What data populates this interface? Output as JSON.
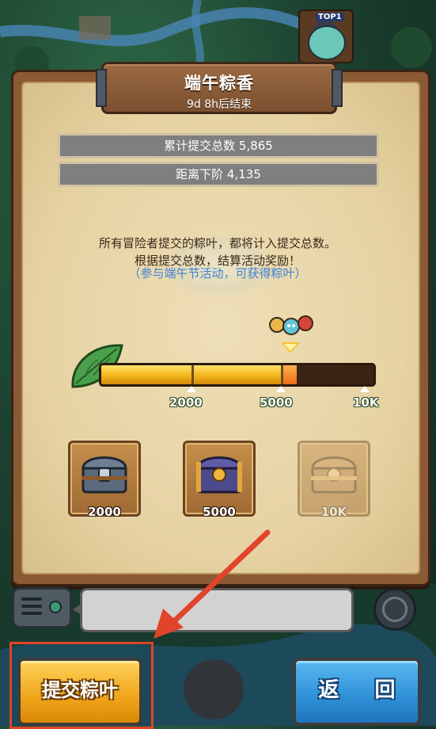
{
  "top_badge": {
    "tag": "TOP1"
  },
  "event": {
    "title": "端午粽香",
    "subtitle": "9d 8h后结束"
  },
  "stats": {
    "total_submitted": "累计提交总数 5,865",
    "to_next_tier": "距离下阶 4,135"
  },
  "description": {
    "line1": "所有冒险者提交的粽叶，都将计入提交总数。",
    "line2": "根据提交总数，结算活动奖励！",
    "line3": "（参与端午节活动，可获得粽叶）"
  },
  "progress": {
    "current_value": 5865,
    "max_value": 10000,
    "milestones": [
      {
        "label": "2000",
        "value": 2000
      },
      {
        "label": "5000",
        "value": 5000
      },
      {
        "label": "10K",
        "value": 10000
      }
    ]
  },
  "rewards": [
    {
      "label": "2000",
      "icon": "steel-chest-icon",
      "state": "available"
    },
    {
      "label": "5000",
      "icon": "royal-chest-icon",
      "state": "available"
    },
    {
      "label": "10K",
      "icon": "golden-chest-icon",
      "state": "locked"
    }
  ],
  "buttons": {
    "submit": "提交粽叶",
    "back": "返 回"
  },
  "colors": {
    "highlight": "#e0442a",
    "progress_fill": "#f3b51b",
    "hint_text": "#3d83d8"
  }
}
